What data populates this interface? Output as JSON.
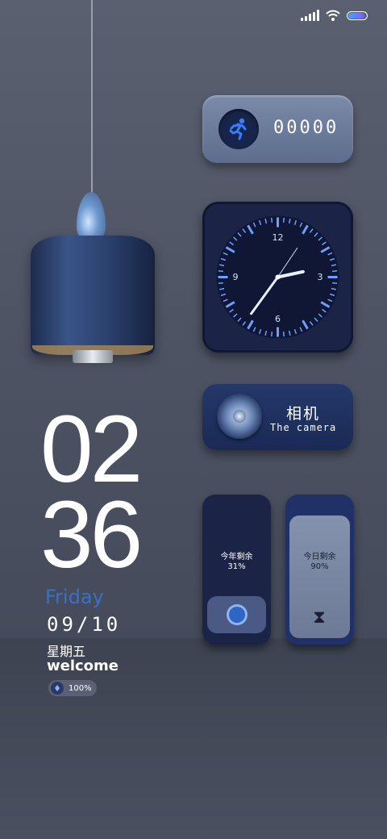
{
  "clock": {
    "hour": "02",
    "minute": "36",
    "day_en": "Friday",
    "date": "09/10",
    "weekday": "星期五",
    "welcome": "welcome"
  },
  "battery_pill": {
    "value": "100%",
    "level": 1.0
  },
  "status_bar": {
    "signal_icon": "signal-icon",
    "wifi_icon": "wifi-icon",
    "battery_icon": "battery-icon",
    "battery_level": 0.9
  },
  "steps_widget": {
    "icon": "running-person-icon",
    "count": "00000"
  },
  "analog_clock": {
    "labels": {
      "top": "12",
      "right": "3",
      "bottom": "6",
      "left": "9"
    },
    "hour": 2,
    "minute": 36,
    "face_color": "#1b2447",
    "tick_color": "#6fa0ff"
  },
  "camera_widget": {
    "icon": "camera-lens-icon",
    "title": "相机",
    "subtitle": "The camera"
  },
  "year_widget": {
    "label": "今年剩余",
    "percent": "31%",
    "icon": "clock-badge-icon"
  },
  "today_widget": {
    "label": "今日剩余",
    "percent": "90%",
    "icon": "hourglass-icon"
  },
  "colors": {
    "accent_blue": "#3c6fc7",
    "widget_dark": "#1b2447",
    "widget_mid": "#6d7a97"
  }
}
